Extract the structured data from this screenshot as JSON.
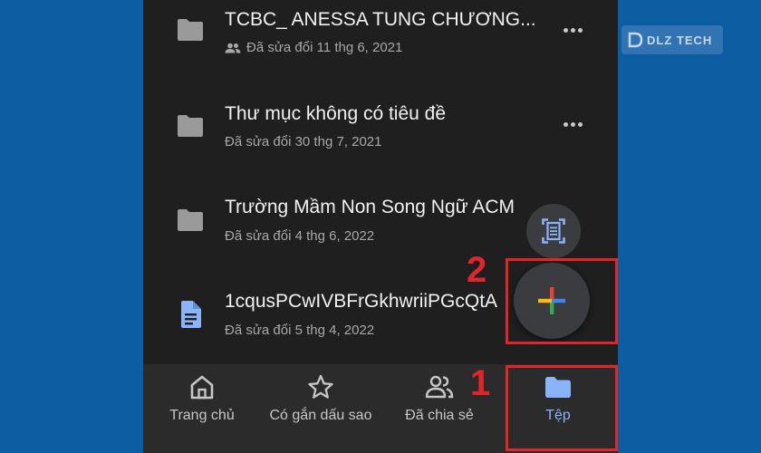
{
  "files": [
    {
      "title": "TCBC_ ANESSA TUNG CHƯƠNG...",
      "subtitle": "Đã sửa đổi 11 thg 6, 2021",
      "icon": "folder-icon",
      "shared": true
    },
    {
      "title": "Thư mục không có tiêu đề",
      "subtitle": "Đã sửa đổi 30 thg 7, 2021",
      "icon": "folder-icon",
      "shared": false
    },
    {
      "title": "Trường Mầm Non Song Ngữ ACM",
      "subtitle": "Đã sửa đổi 4 thg 6, 2022",
      "icon": "folder-icon",
      "shared": false
    },
    {
      "title": "1cqusPCwIVBFrGkhwriiPGcQtA",
      "subtitle": "Đã sửa đổi 5 thg 4, 2022",
      "icon": "document-icon",
      "shared": false
    }
  ],
  "nav": [
    {
      "label": "Trang chủ",
      "icon": "home-icon",
      "active": false
    },
    {
      "label": "Có gắn dấu sao",
      "icon": "star-icon",
      "active": false
    },
    {
      "label": "Đã chia sẻ",
      "icon": "shared-people-icon",
      "active": false
    },
    {
      "label": "Tệp",
      "icon": "folder-icon",
      "active": true
    }
  ],
  "steps": {
    "one": "1",
    "two": "2"
  },
  "watermark": {
    "text": "DLZ TECH"
  },
  "colors": {
    "background": "#0d5da3",
    "screen": "#1f1f1f",
    "accent": "#8ab4f8",
    "highlight": "#e0262a"
  }
}
